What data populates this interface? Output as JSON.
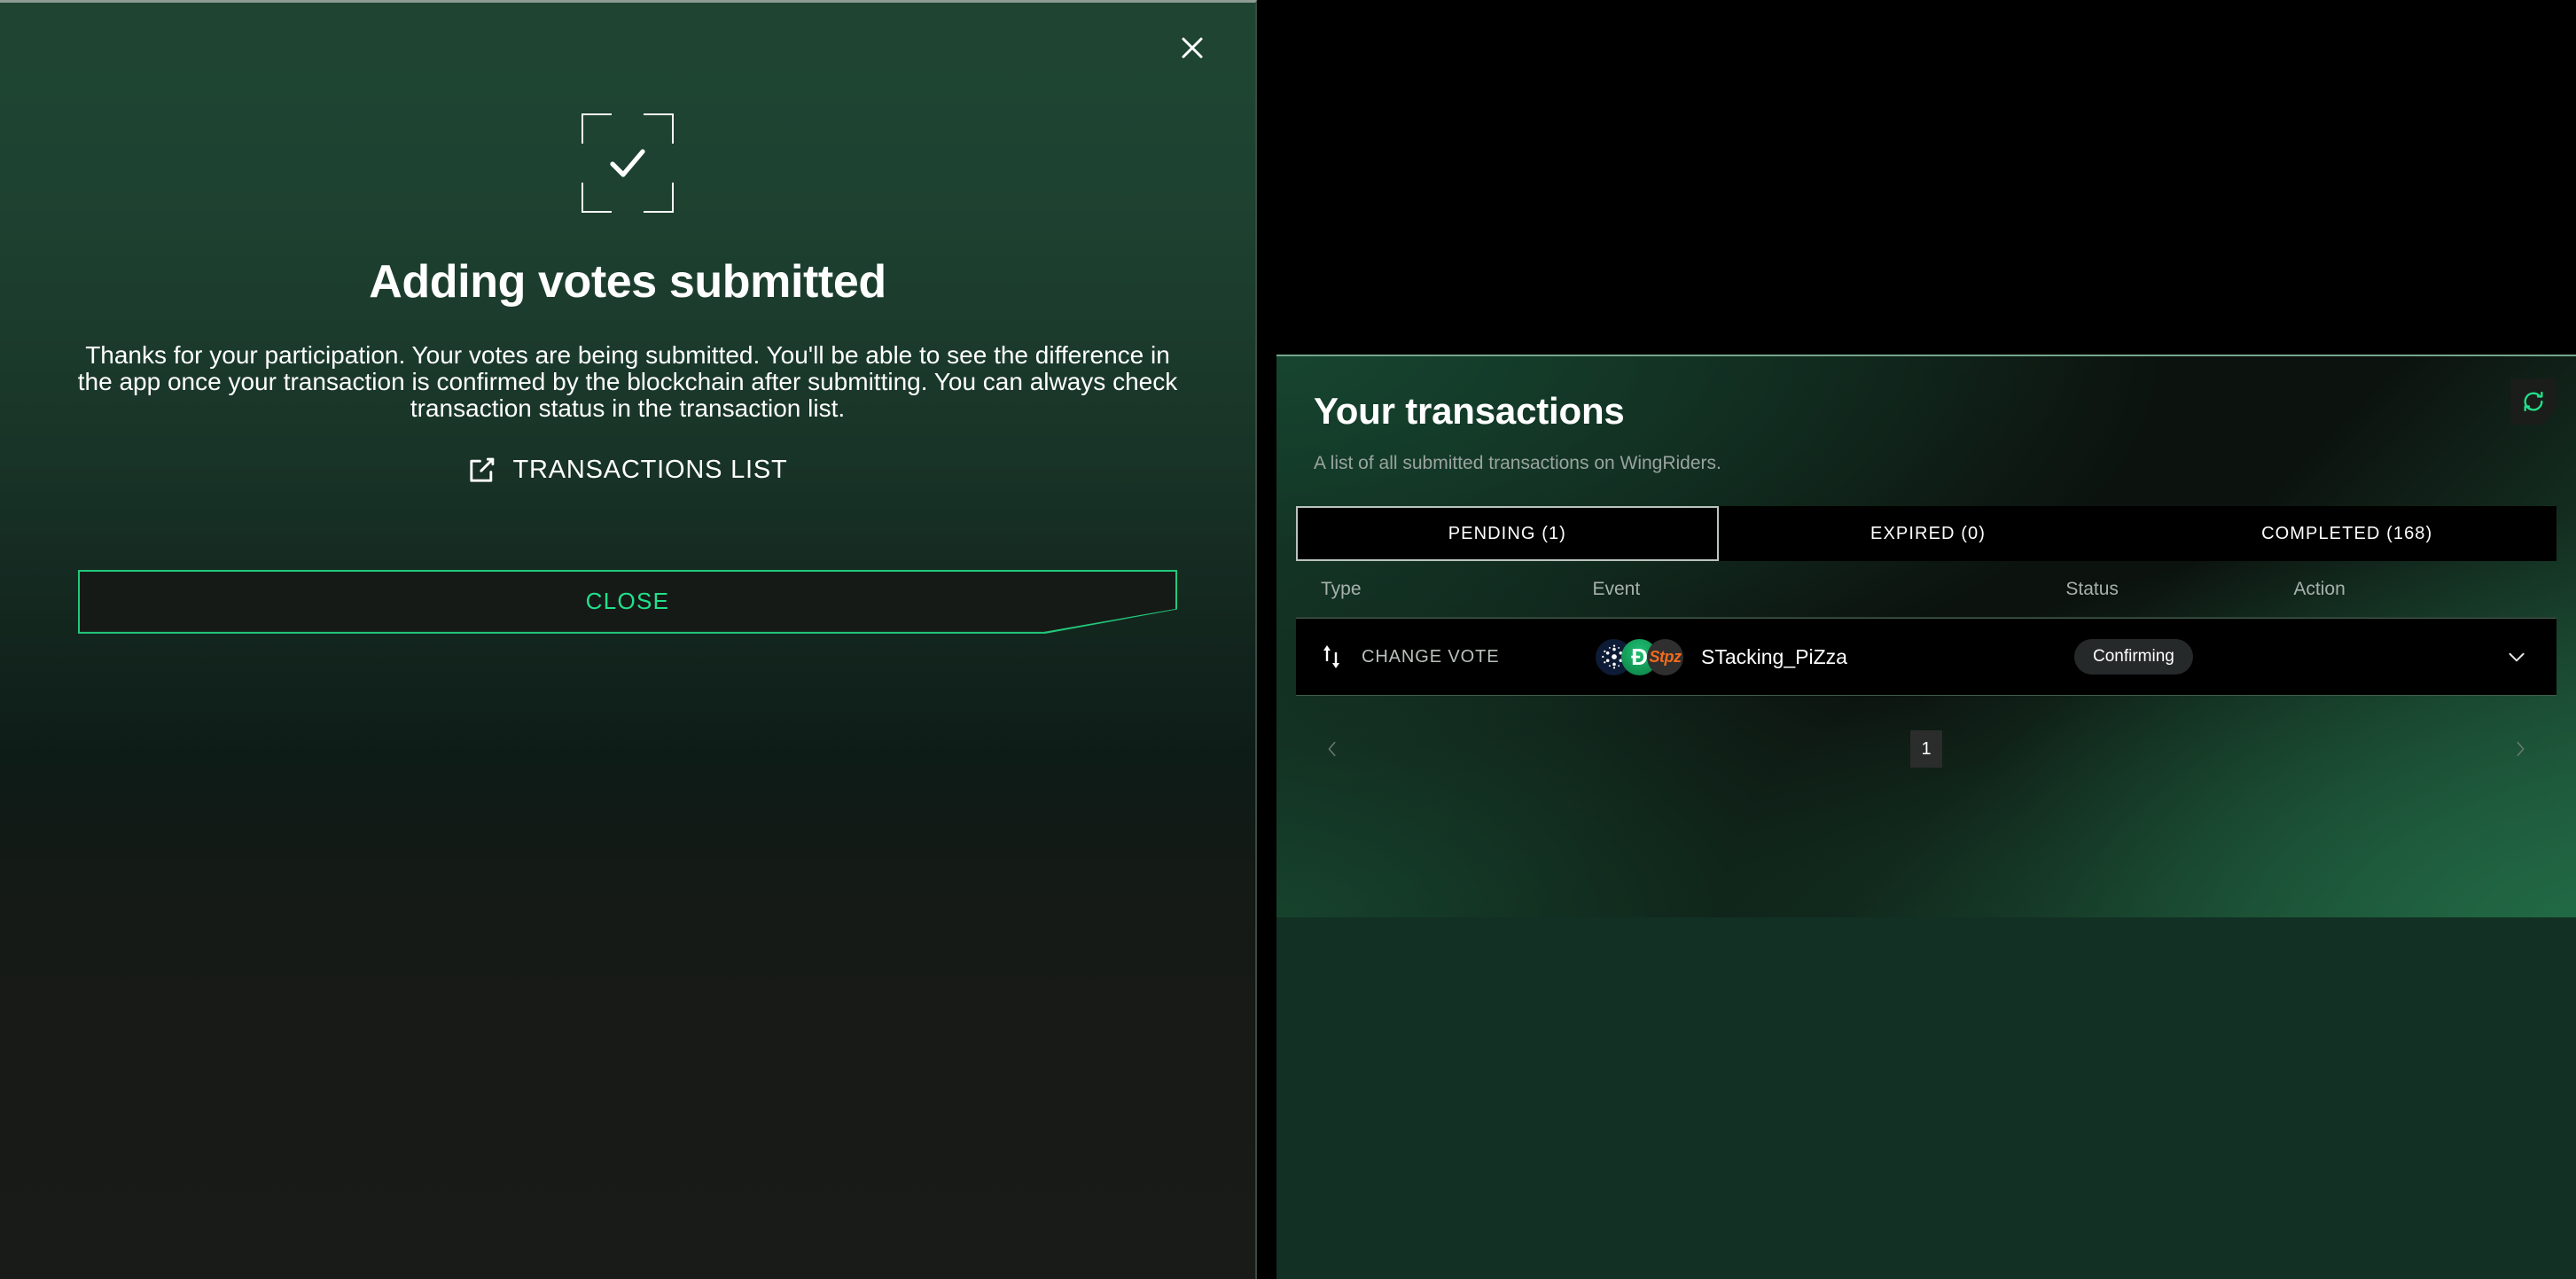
{
  "modal": {
    "close_icon": "close-icon",
    "status_icon": "success-check-icon",
    "title": "Adding votes submitted",
    "body": "Thanks for your participation. Your votes are being submitted. You'll be able to see the difference in the app once your transaction is confirmed by the blockchain after submitting. You can always check transaction status in the transaction list.",
    "link_icon": "external-link-icon",
    "link_label": "TRANSACTIONS LIST",
    "close_button_label": "CLOSE",
    "accent_color": "#22e08a"
  },
  "transactions": {
    "title": "Your transactions",
    "subtitle": "A list of all submitted transactions on WingRiders.",
    "refresh_icon": "refresh-icon",
    "tabs": [
      {
        "label": "PENDING (1)",
        "active": true
      },
      {
        "label": "EXPIRED (0)",
        "active": false
      },
      {
        "label": "COMPLETED (168)",
        "active": false
      }
    ],
    "columns": {
      "type": "Type",
      "event": "Event",
      "status": "Status",
      "action": "Action"
    },
    "rows": [
      {
        "type_icon": "swap-vertical-icon",
        "type": "CHANGE VOTE",
        "tokens": [
          "cardano-icon",
          "dogecoin-icon",
          "stpz-icon"
        ],
        "token_labels": [
          "",
          "Ð",
          "Stpz"
        ],
        "event": "STacking_PiZza",
        "status": "Confirming",
        "action_icon": "chevron-down-icon"
      }
    ],
    "pagination": {
      "prev_icon": "chevron-left-icon",
      "next_icon": "chevron-right-icon",
      "pages": [
        "1"
      ],
      "current": "1"
    }
  }
}
